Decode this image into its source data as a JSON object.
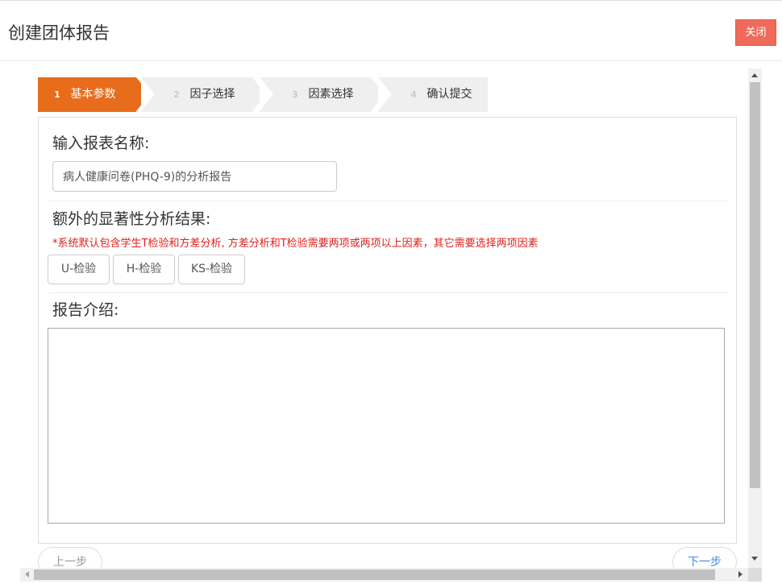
{
  "dialog": {
    "title": "创建团体报告",
    "close_label": "关闭"
  },
  "steps": [
    {
      "num": "1",
      "label": "基本参数",
      "active": true
    },
    {
      "num": "2",
      "label": "因子选择",
      "active": false
    },
    {
      "num": "3",
      "label": "因素选择",
      "active": false
    },
    {
      "num": "4",
      "label": "确认提交",
      "active": false
    }
  ],
  "form": {
    "name_label": "输入报表名称:",
    "name_value": "病人健康问卷(PHQ-9)的分析报告",
    "extra_label": "额外的显著性分析结果:",
    "hint": "*系统默认包含学生T检验和方差分析, 方差分析和T检验需要两项或两项以上因素，其它需要选择两项因素",
    "tests": [
      "U-检验",
      "H-检验",
      "KS-检验"
    ],
    "intro_label": "报告介绍:",
    "intro_value": ""
  },
  "nav": {
    "prev_label": "上一步",
    "next_label": "下一步"
  },
  "colors": {
    "accent": "#e76c1b",
    "close": "#ee6a5a",
    "hint": "#e0201a",
    "next": "#3a8ee6"
  }
}
